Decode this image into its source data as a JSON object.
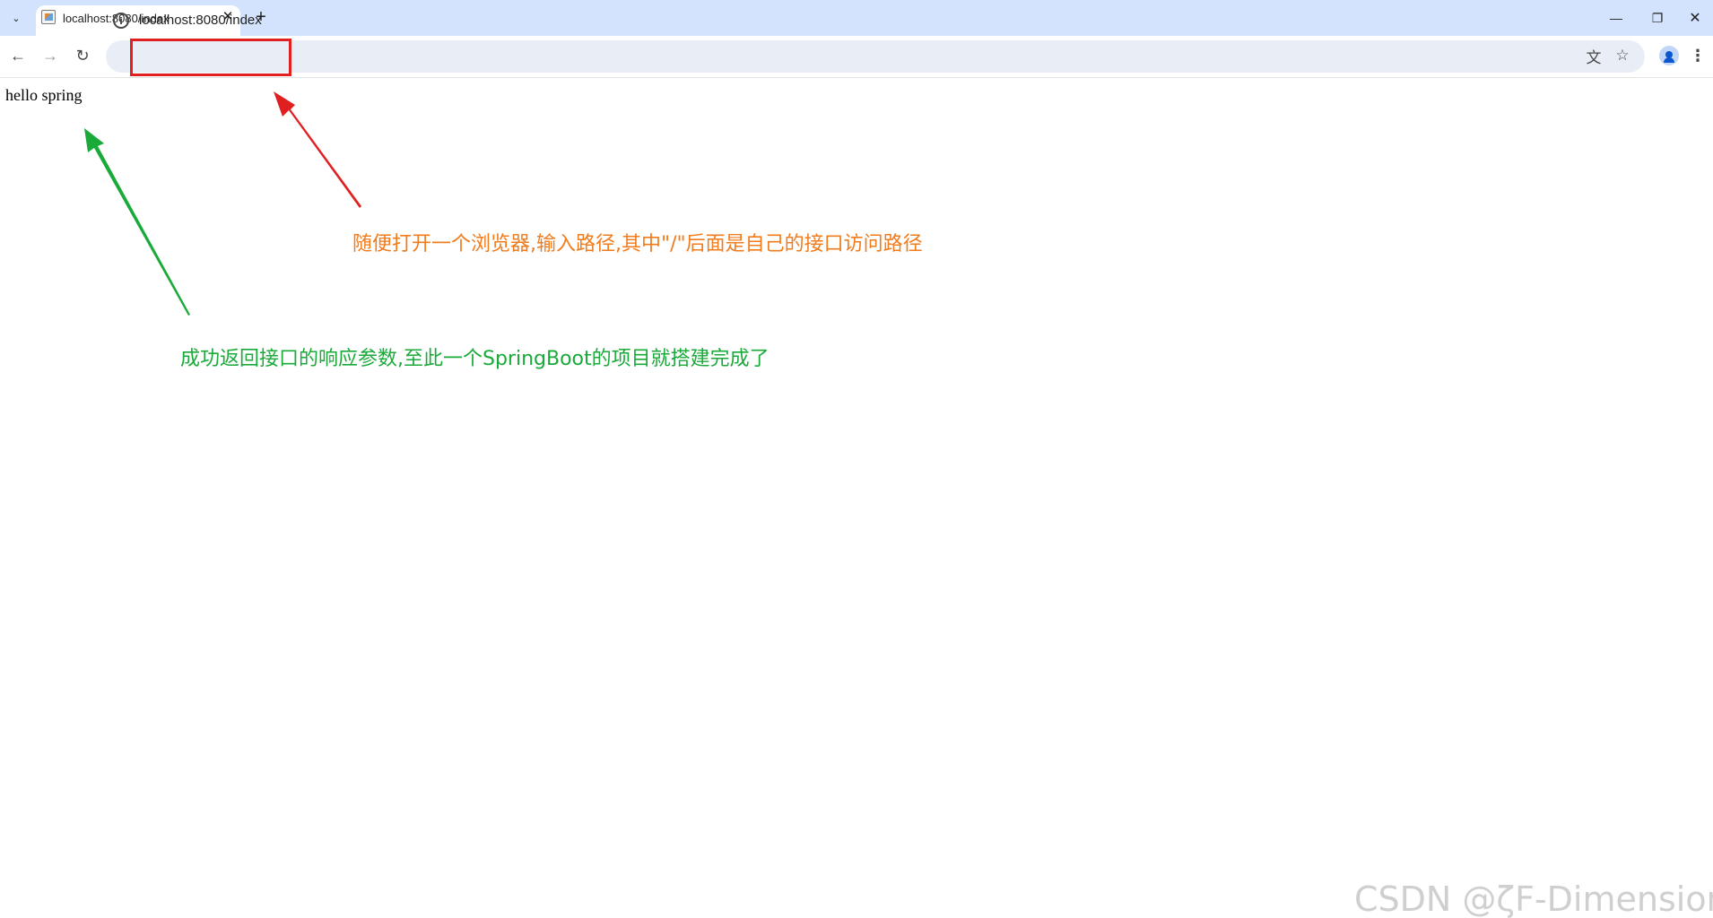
{
  "browser": {
    "tab": {
      "title": "localhost:8080/index",
      "close_glyph": "✕"
    },
    "new_tab_glyph": "+",
    "tab_search_glyph": "⌄",
    "window": {
      "minimize_glyph": "—",
      "restore_glyph": "❐",
      "close_glyph": "✕"
    },
    "nav": {
      "back_glyph": "←",
      "forward_glyph": "→",
      "reload_glyph": "↻"
    },
    "omnibox": {
      "site_info_glyph": "i",
      "url": "localhost:8080/index",
      "translate_glyph": "文",
      "star_glyph": "☆"
    },
    "menu_glyph": "⋮"
  },
  "page": {
    "body_text": "hello spring"
  },
  "annotations": {
    "orange": "随便打开一个浏览器,输入路径,其中\"/\"后面是自己的接口访问路径",
    "green": "成功返回接口的响应参数,至此一个SpringBoot的项目就搭建完成了",
    "watermark": "CSDN @ζF-Dimensionあ"
  },
  "colors": {
    "highlight_box": "#e02020",
    "arrow_red": "#e02020",
    "arrow_green": "#1aaa3a",
    "annotation_orange": "#f07c1e",
    "annotation_green": "#1aaa3a"
  }
}
